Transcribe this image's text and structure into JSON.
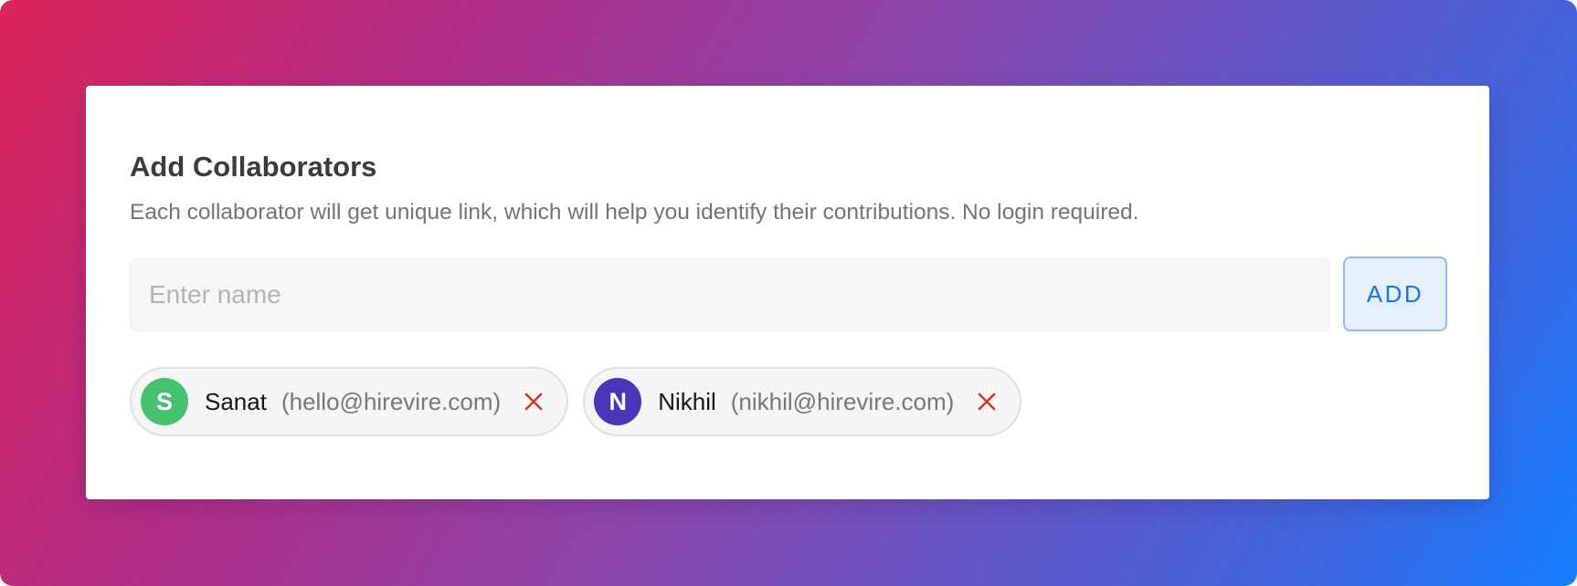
{
  "dialog": {
    "title": "Add Collaborators",
    "description": "Each collaborator will get unique link, which will help you identify their contributions. No login required."
  },
  "name_input": {
    "value": "",
    "placeholder": "Enter name"
  },
  "add_button": {
    "label": "ADD"
  },
  "collaborators": [
    {
      "initial": "S",
      "name": "Sanat",
      "email": "(hello@hirevire.com)",
      "avatar_color": "#45c26e",
      "remove_icon": "close-icon"
    },
    {
      "initial": "N",
      "name": "Nikhil",
      "email": "(nikhil@hirevire.com)",
      "avatar_color": "#4a36b8",
      "remove_icon": "close-icon"
    }
  ],
  "colors": {
    "accent": "#1a73e8",
    "remove": "#d9372b",
    "gradient_start": "#dc2459",
    "gradient_end": "#137eff"
  }
}
